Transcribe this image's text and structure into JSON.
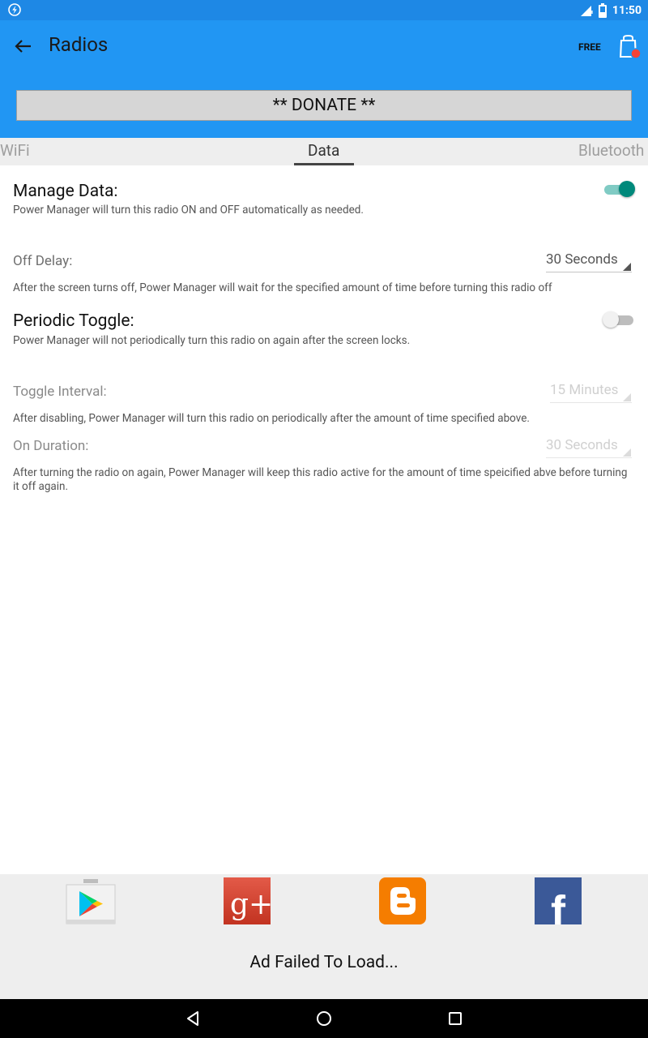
{
  "status_bar": {
    "time": "11:50"
  },
  "app_bar": {
    "title": "Radios",
    "free_label": "FREE",
    "donate_label": "** DONATE **"
  },
  "tabs": [
    {
      "label": "WiFi",
      "active": false
    },
    {
      "label": "Data",
      "active": true
    },
    {
      "label": "Bluetooth",
      "active": false
    }
  ],
  "settings": {
    "manage_data": {
      "title": "Manage Data:",
      "description": "Power Manager will turn this radio ON and OFF automatically as needed.",
      "enabled": true
    },
    "off_delay": {
      "label": "Off Delay:",
      "value": "30 Seconds",
      "description": "After the screen turns off, Power Manager will wait for the specified amount of time before turning this radio off"
    },
    "periodic_toggle": {
      "title": "Periodic Toggle:",
      "description": "Power Manager will not periodically turn this radio on again after the screen locks.",
      "enabled": false
    },
    "toggle_interval": {
      "label": "Toggle Interval:",
      "value": "15 Minutes",
      "description": "After disabling, Power Manager will turn this radio on periodically after the amount of time specified above."
    },
    "on_duration": {
      "label": "On Duration:",
      "value": "30 Seconds",
      "description": "After turning the radio on again, Power Manager will keep this radio active for the amount of time speicified abve before turning it off again."
    }
  },
  "social": {
    "icons": [
      "play-store-icon",
      "google-plus-icon",
      "blogger-icon",
      "facebook-icon"
    ],
    "google_plus_text": "g+",
    "facebook_text": "f",
    "ad_text": "Ad Failed To Load..."
  },
  "colors": {
    "status_bar": "#1e88e5",
    "app_bar": "#2196f3",
    "switch_on": "#00897b",
    "google_plus": "#dd4b39",
    "blogger": "#f57d00",
    "facebook": "#3b5998"
  }
}
